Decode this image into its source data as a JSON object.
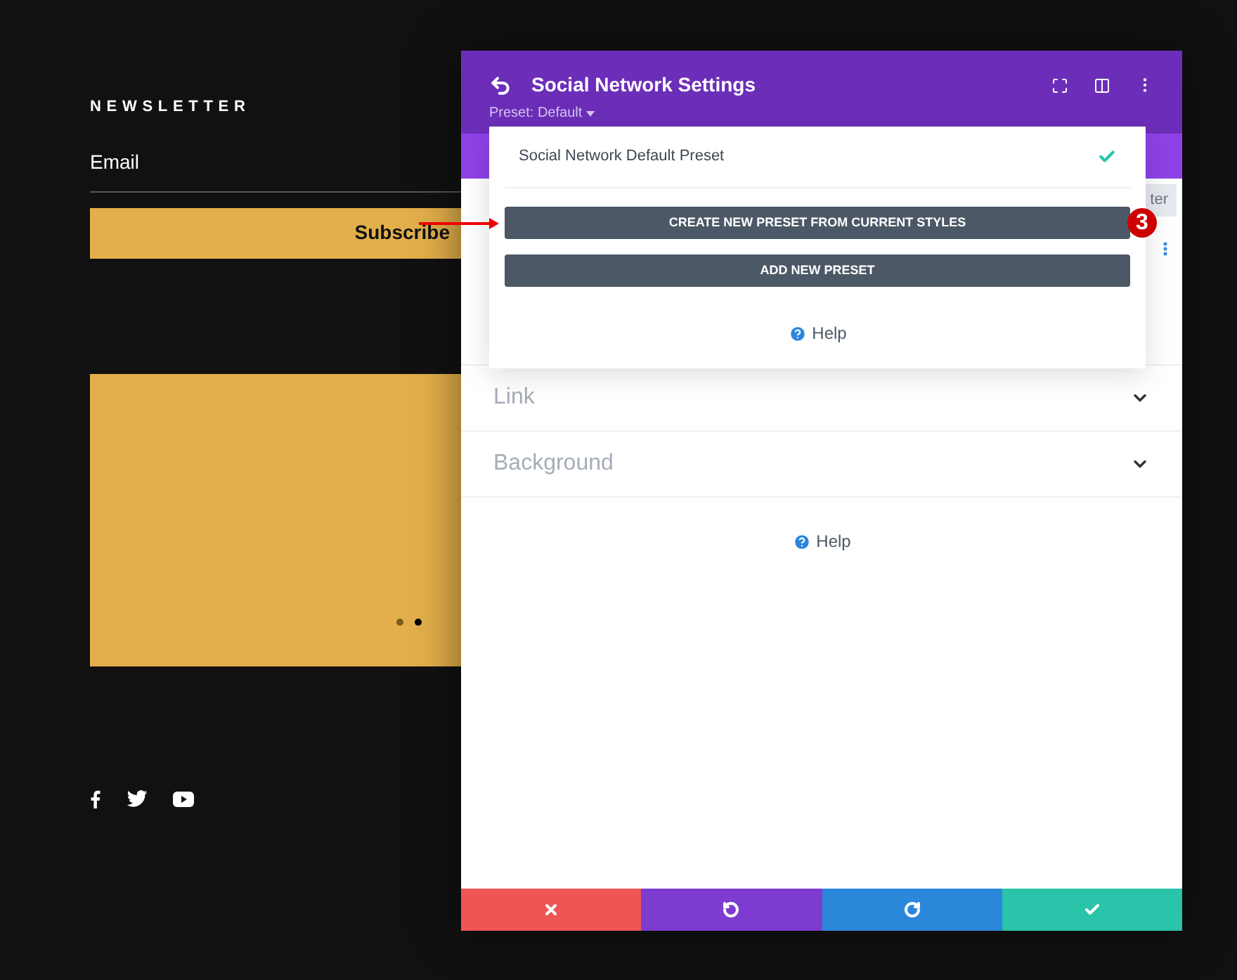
{
  "page": {
    "newsletter_title": "NEWSLETTER",
    "email_placeholder": "Email",
    "subscribe_button": "Subscribe",
    "slider_dots": [
      {
        "selected": false
      },
      {
        "selected": true
      }
    ]
  },
  "modal": {
    "title": "Social Network Settings",
    "preset_label": "Preset: Default",
    "behind_button": "ter",
    "sections": [
      {
        "label": "Link"
      },
      {
        "label": "Background"
      }
    ],
    "help": "Help",
    "footer_buttons": [
      {
        "kind": "discard"
      },
      {
        "kind": "undo"
      },
      {
        "kind": "redo"
      },
      {
        "kind": "save"
      }
    ]
  },
  "preset_menu": {
    "items": [
      {
        "label": "Social Network Default Preset",
        "selected": true
      }
    ],
    "buttons": [
      "CREATE NEW PRESET FROM CURRENT STYLES",
      "ADD NEW PRESET"
    ],
    "help": "Help"
  },
  "annotation": {
    "badge": "3"
  }
}
